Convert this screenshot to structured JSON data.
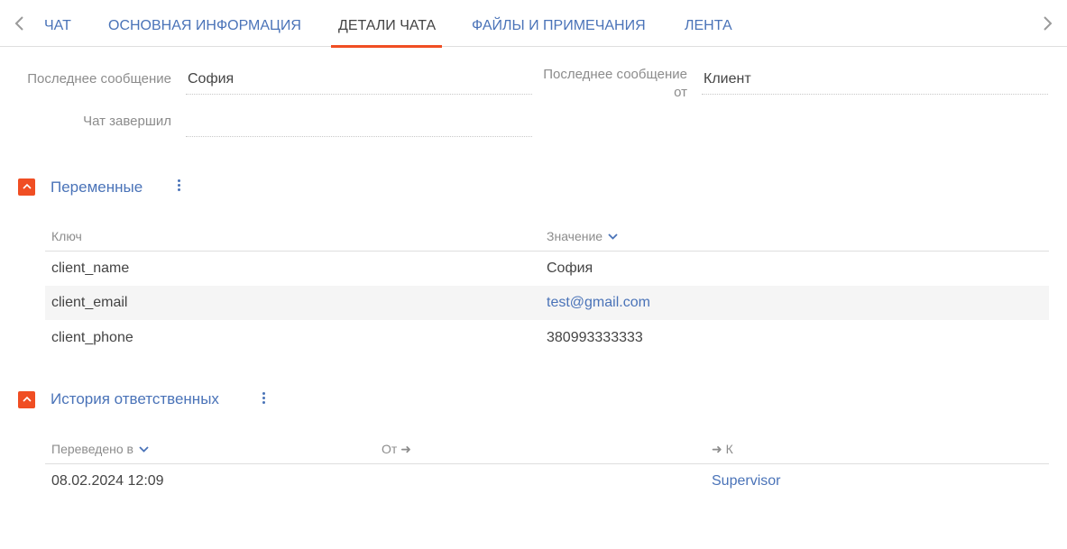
{
  "tabs": {
    "items": [
      "ЧАТ",
      "ОСНОВНАЯ ИНФОРМАЦИЯ",
      "ДЕТАЛИ ЧАТА",
      "ФАЙЛЫ И ПРИМЕЧАНИЯ",
      "ЛЕНТА"
    ],
    "active": "ДЕТАЛИ ЧАТА",
    "left_icon": "chevron-left-icon",
    "right_icon": "chevron-right-icon"
  },
  "fields": {
    "last_message": {
      "label": "Последнее сообщение",
      "value": "София"
    },
    "last_message_from": {
      "label_line1": "Последнее сообщение",
      "label_line2": "от",
      "value": "Клиент"
    },
    "chat_ended_by": {
      "label": "Чат завершил",
      "value": ""
    }
  },
  "variables": {
    "title": "Переменные",
    "columns": {
      "key": "Ключ",
      "value": "Значение"
    },
    "rows": [
      {
        "key": "client_name",
        "value": "София"
      },
      {
        "key": "client_email",
        "value": "test@gmail.com"
      },
      {
        "key": "client_phone",
        "value": "380993333333"
      }
    ]
  },
  "history": {
    "title": "История ответственных",
    "columns": {
      "transferred": "Переведено в",
      "from": "От",
      "to": "К"
    },
    "rows": [
      {
        "transferred": "08.02.2024 12:09",
        "from": "",
        "to": "Supervisor"
      }
    ]
  },
  "colors": {
    "accent": "#f04e23",
    "link": "#4a73b8",
    "text": "#444444",
    "muted": "#8c8c8c"
  }
}
